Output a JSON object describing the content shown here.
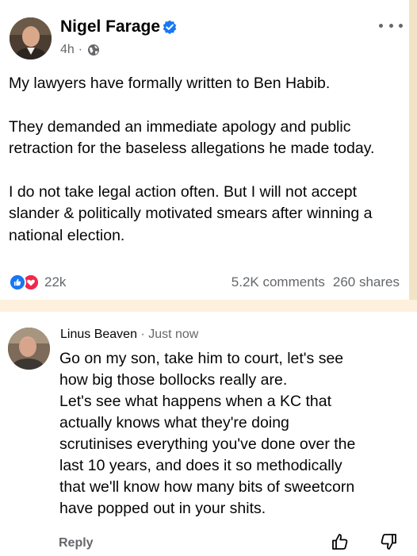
{
  "post": {
    "author_name": "Nigel Farage",
    "timestamp": "4h",
    "separator": "·",
    "privacy_icon": "globe-icon",
    "verified_icon": "verified-badge-icon",
    "paragraphs": [
      "My lawyers have formally written to Ben Habib.",
      "They demanded an immediate apology and public retraction for the baseless allegations he made today.",
      "I do not take legal action often. But I will not accept slander & politically motivated smears after winning a national election."
    ],
    "reactions": {
      "icons": [
        "like-reaction-icon",
        "love-reaction-icon"
      ],
      "count": "22k"
    },
    "comments_count": "5.2K comments",
    "shares_count": "260 shares"
  },
  "comment": {
    "author_name": "Linus Beaven",
    "separator": " · ",
    "timestamp": "Just now",
    "text_lines": [
      "Go on my son, take him to court, let's see",
      "how big those bollocks really are.",
      "Let's see what happens when a KC that",
      "actually knows what they're doing",
      "scrutinises everything you've done over the",
      "last 10 years, and does it so methodically",
      "that we'll know how many bits of sweetcorn",
      "have popped out in your shits."
    ],
    "reply_label": "Reply",
    "actions": [
      "thumbs-up-icon",
      "thumbs-down-icon"
    ]
  },
  "colors": {
    "background": "#fdf0dc",
    "card": "#ffffff",
    "text": "#050505",
    "secondary_text": "#65676b",
    "facebook_blue": "#1877f2",
    "love_red": "#f02849"
  }
}
